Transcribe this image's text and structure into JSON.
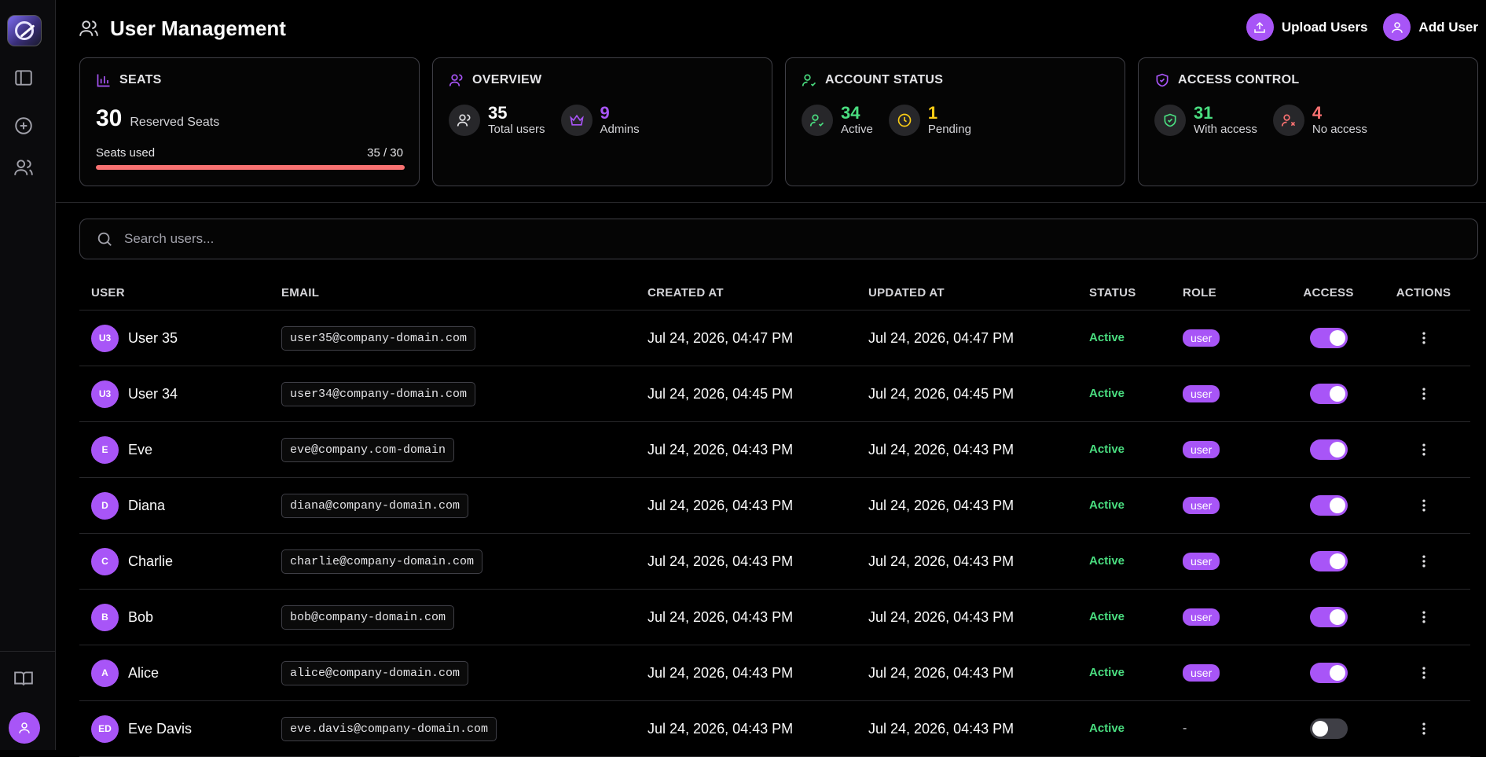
{
  "header": {
    "title": "User Management",
    "upload_label": "Upload Users",
    "add_label": "Add User"
  },
  "seats": {
    "title": "SEATS",
    "reserved": "30",
    "reserved_label": "Reserved Seats",
    "used_label": "Seats used",
    "used_value": "35 / 30",
    "fill_fraction": 1.0,
    "bar_color": "#f87171"
  },
  "overview": {
    "title": "OVERVIEW",
    "total": "35",
    "total_label": "Total users",
    "admins": "9",
    "admins_label": "Admins"
  },
  "account_status": {
    "title": "ACCOUNT STATUS",
    "active": "34",
    "active_label": "Active",
    "pending": "1",
    "pending_label": "Pending"
  },
  "access_control": {
    "title": "ACCESS CONTROL",
    "with_access": "31",
    "with_access_label": "With access",
    "no_access": "4",
    "no_access_label": "No access"
  },
  "colors": {
    "accent": "#a855f7",
    "green": "#4ade80",
    "yellow": "#facc15",
    "red": "#f87171"
  },
  "search": {
    "placeholder": "Search users..."
  },
  "table": {
    "columns": [
      "USER",
      "EMAIL",
      "CREATED AT",
      "UPDATED AT",
      "STATUS",
      "ROLE",
      "ACCESS",
      "ACTIONS"
    ],
    "rows": [
      {
        "initials": "U3",
        "name": "User 35",
        "email": "user35@company-domain.com",
        "created": "Jul 24, 2026, 04:47 PM",
        "updated": "Jul 24, 2026, 04:47 PM",
        "status": "Active",
        "role": "user",
        "access": true
      },
      {
        "initials": "U3",
        "name": "User 34",
        "email": "user34@company-domain.com",
        "created": "Jul 24, 2026, 04:45 PM",
        "updated": "Jul 24, 2026, 04:45 PM",
        "status": "Active",
        "role": "user",
        "access": true
      },
      {
        "initials": "E",
        "name": "Eve",
        "email": "eve@company.com-domain",
        "created": "Jul 24, 2026, 04:43 PM",
        "updated": "Jul 24, 2026, 04:43 PM",
        "status": "Active",
        "role": "user",
        "access": true
      },
      {
        "initials": "D",
        "name": "Diana",
        "email": "diana@company-domain.com",
        "created": "Jul 24, 2026, 04:43 PM",
        "updated": "Jul 24, 2026, 04:43 PM",
        "status": "Active",
        "role": "user",
        "access": true
      },
      {
        "initials": "C",
        "name": "Charlie",
        "email": "charlie@company-domain.com",
        "created": "Jul 24, 2026, 04:43 PM",
        "updated": "Jul 24, 2026, 04:43 PM",
        "status": "Active",
        "role": "user",
        "access": true
      },
      {
        "initials": "B",
        "name": "Bob",
        "email": "bob@company-domain.com",
        "created": "Jul 24, 2026, 04:43 PM",
        "updated": "Jul 24, 2026, 04:43 PM",
        "status": "Active",
        "role": "user",
        "access": true
      },
      {
        "initials": "A",
        "name": "Alice",
        "email": "alice@company-domain.com",
        "created": "Jul 24, 2026, 04:43 PM",
        "updated": "Jul 24, 2026, 04:43 PM",
        "status": "Active",
        "role": "user",
        "access": true
      },
      {
        "initials": "ED",
        "name": "Eve Davis",
        "email": "eve.davis@company-domain.com",
        "created": "Jul 24, 2026, 04:43 PM",
        "updated": "Jul 24, 2026, 04:43 PM",
        "status": "Active",
        "role": "-",
        "access": false
      }
    ]
  }
}
